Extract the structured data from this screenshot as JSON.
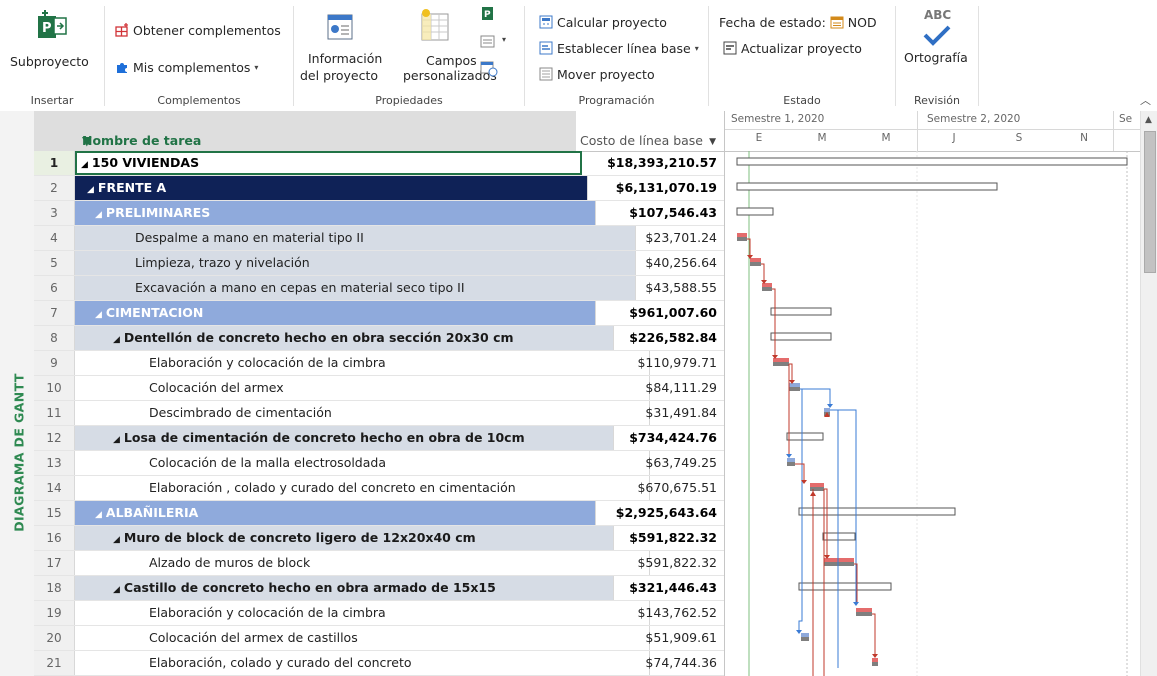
{
  "ribbon": {
    "insertar": {
      "subproyecto": "Subproyecto",
      "label": "Insertar"
    },
    "complementos": {
      "obtener": "Obtener complementos",
      "mis": "Mis complementos",
      "label": "Complementos"
    },
    "propiedades": {
      "info_line1": "Información",
      "info_line2": "del proyecto",
      "campos_line1": "Campos",
      "campos_line2": "personalizados",
      "label": "Propiedades"
    },
    "programacion": {
      "calcular": "Calcular proyecto",
      "establecer": "Establecer línea base",
      "mover": "Mover proyecto",
      "label": "Programación"
    },
    "estado": {
      "fecha_label": "Fecha de estado:",
      "fecha_value": "NOD",
      "actualizar": "Actualizar proyecto",
      "label": "Estado"
    },
    "revision": {
      "abc": "ABC",
      "ortografia": "Ortografía",
      "label": "Revisión"
    }
  },
  "sidebar": {
    "view_label": "DIAGRAMA DE GANTT"
  },
  "table": {
    "col_name": "Nombre de tarea",
    "col_cost": "Costo de línea base",
    "rows": [
      {
        "id": "1",
        "name": "150 VIVIENDAS",
        "cost": "$18,393,210.57"
      },
      {
        "id": "2",
        "name": "FRENTE A",
        "cost": "$6,131,070.19"
      },
      {
        "id": "3",
        "name": "PRELIMINARES",
        "cost": "$107,546.43"
      },
      {
        "id": "4",
        "name": "Despalme a mano en material tipo II",
        "cost": "$23,701.24"
      },
      {
        "id": "5",
        "name": "Limpieza, trazo y nivelación",
        "cost": "$40,256.64"
      },
      {
        "id": "6",
        "name": "Excavación a mano en cepas en material seco tipo II",
        "cost": "$43,588.55"
      },
      {
        "id": "7",
        "name": "CIMENTACION",
        "cost": "$961,007.60"
      },
      {
        "id": "8",
        "name": "Dentellón de concreto hecho en obra sección 20x30 cm",
        "cost": "$226,582.84"
      },
      {
        "id": "9",
        "name": "Elaboración y colocación de la cimbra",
        "cost": "$110,979.71"
      },
      {
        "id": "10",
        "name": "Colocación del armex",
        "cost": "$84,111.29"
      },
      {
        "id": "11",
        "name": "Descimbrado de cimentación",
        "cost": "$31,491.84"
      },
      {
        "id": "12",
        "name": "Losa de cimentación de concreto hecho en obra de 10cm",
        "cost": "$734,424.76"
      },
      {
        "id": "13",
        "name": "Colocación de la malla electrosoldada",
        "cost": "$63,749.25"
      },
      {
        "id": "14",
        "name": "Elaboración , colado y curado del concreto en cimentación",
        "cost": "$670,675.51"
      },
      {
        "id": "15",
        "name": "ALBAÑILERIA",
        "cost": "$2,925,643.64"
      },
      {
        "id": "16",
        "name": "Muro de block de concreto ligero de 12x20x40 cm",
        "cost": "$591,822.32"
      },
      {
        "id": "17",
        "name": "Alzado de muros de block",
        "cost": "$591,822.32"
      },
      {
        "id": "18",
        "name": "Castillo de concreto hecho en obra armado de 15x15",
        "cost": "$321,446.43"
      },
      {
        "id": "19",
        "name": "Elaboración y colocación de la cimbra",
        "cost": "$143,762.52"
      },
      {
        "id": "20",
        "name": "Colocación del armex de castillos",
        "cost": "$51,909.61"
      },
      {
        "id": "21",
        "name": "Elaboración, colado y curado del concreto",
        "cost": "$74,744.36"
      }
    ]
  },
  "timescale": {
    "top": [
      "Semestre 1, 2020",
      "Semestre 2, 2020",
      "Se"
    ],
    "bottom": [
      "E",
      "M",
      "M",
      "J",
      "S",
      "N"
    ]
  },
  "colors": {
    "accent": "#217346",
    "frente": "#0f2257",
    "fase": "#8faadc",
    "grupo": "#d6dce5",
    "critical": "#e46c6c",
    "link_blue": "#3a7bd5"
  }
}
